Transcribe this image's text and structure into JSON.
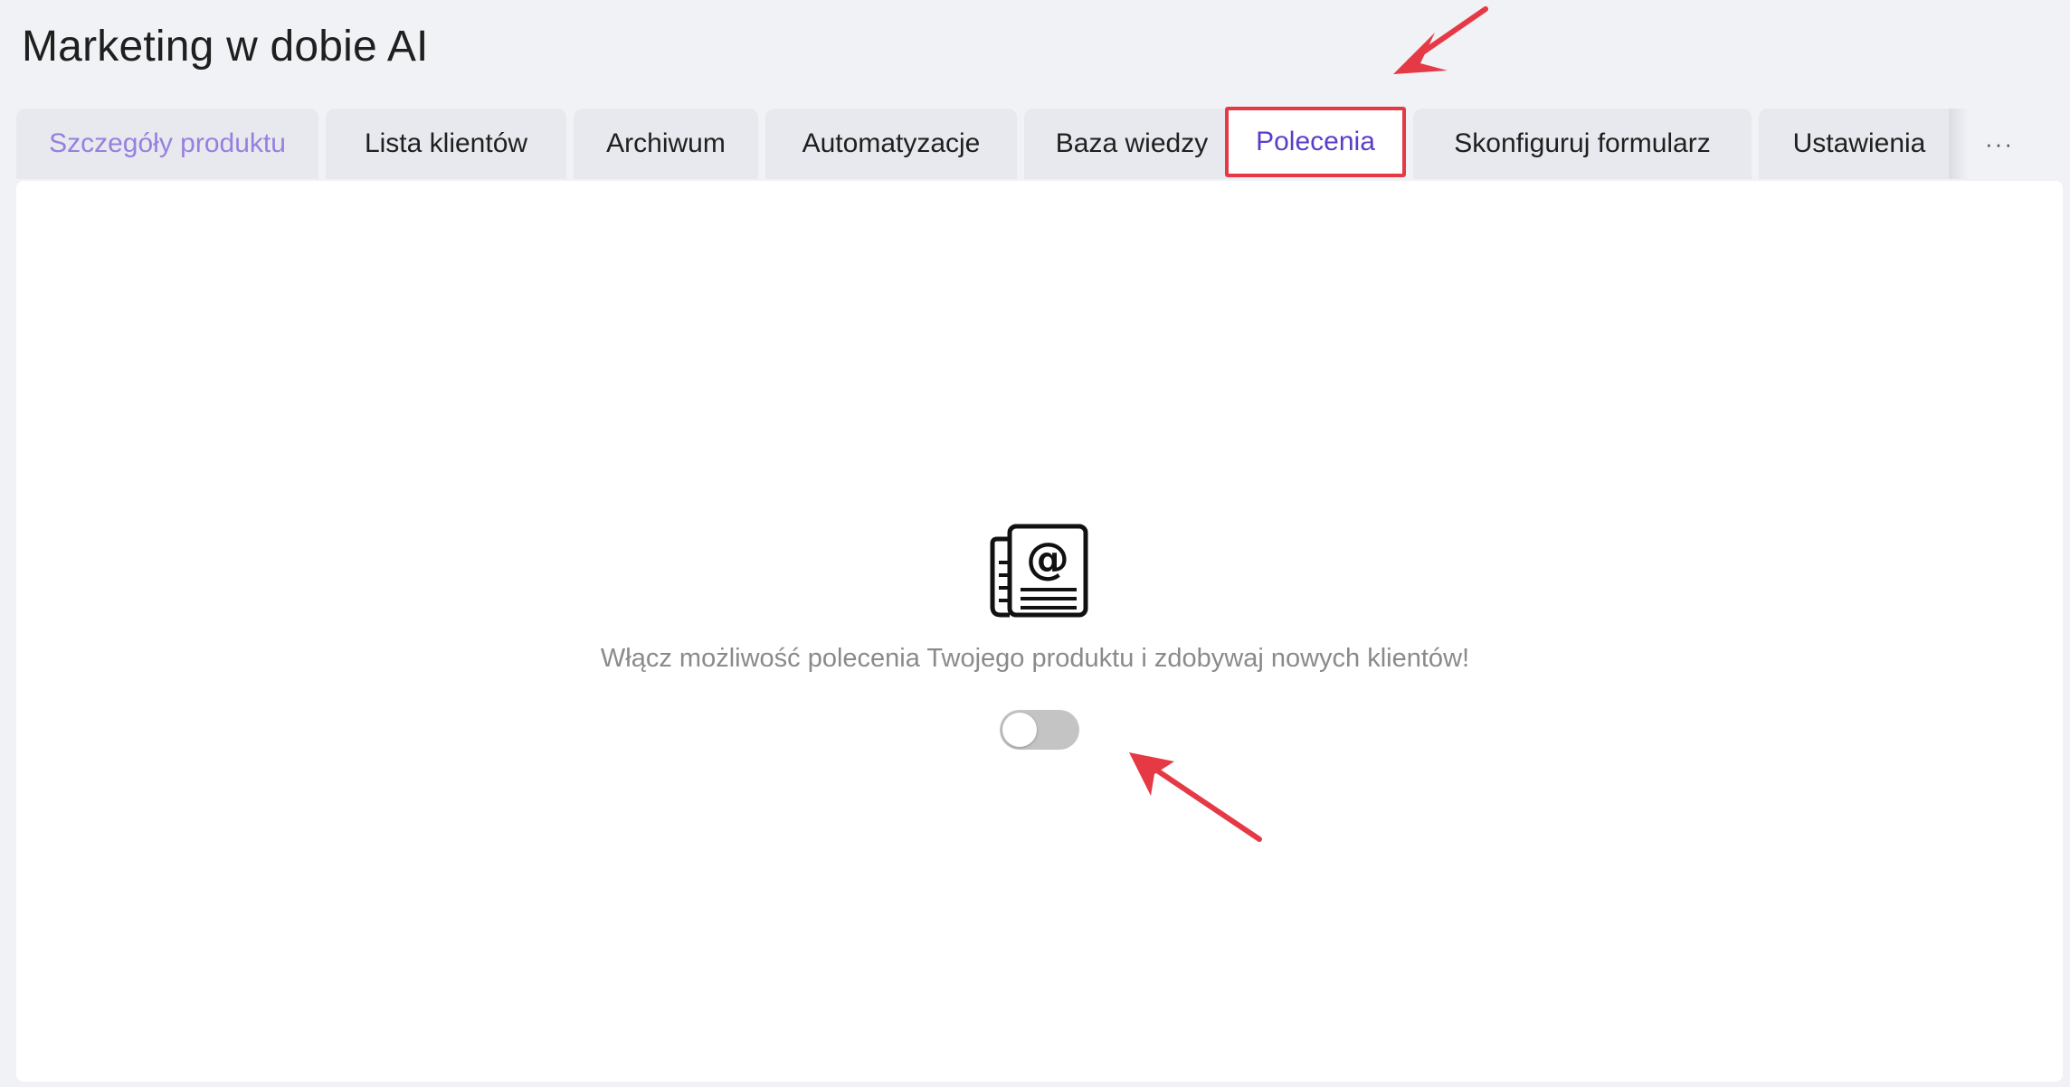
{
  "header": {
    "title": "Marketing w dobie AI"
  },
  "tabs": [
    {
      "label": "Szczegóły produktu"
    },
    {
      "label": "Lista klientów"
    },
    {
      "label": "Archiwum"
    },
    {
      "label": "Automatyzacje"
    },
    {
      "label": "Baza wiedzy"
    },
    {
      "label": "Polecenia"
    },
    {
      "label": "Skonfiguruj formularz"
    },
    {
      "label": "Ustawienia"
    }
  ],
  "more_tabs_label": "···",
  "active_tab": "Polecenia",
  "empty_state": {
    "icon": "newsletter-at-icon",
    "message": "Włącz możliwość polecenia Twojego produktu i zdobywaj nowych klientów!",
    "toggle_enabled": false
  },
  "colors": {
    "accent": "#5a3ec8",
    "first_tab_text": "#9680e0",
    "highlight_red": "#e63946",
    "toggle_off": "#c4c4c4"
  }
}
